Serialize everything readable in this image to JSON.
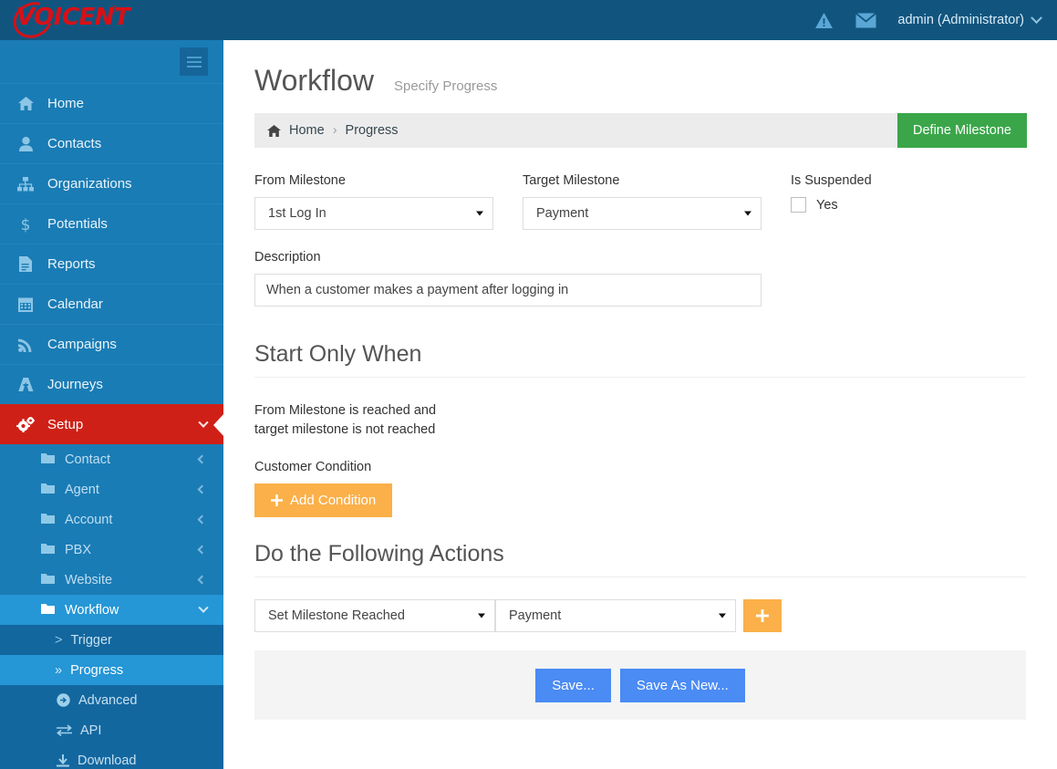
{
  "brand": {
    "logo_text": "VOICENT",
    "logo_registered": "®",
    "logo_color": "#d81016"
  },
  "header": {
    "warning_icon": "warning-triangle-icon",
    "mail_icon": "envelope-icon",
    "user_label": "admin (Administrator)",
    "bg_color": "#11557f"
  },
  "sidebar": {
    "bg_color": "#1a7cb5",
    "active_color": "#cf2017",
    "toggle_icon": "hamburger-icon",
    "items": [
      {
        "label": "Home",
        "icon": "home-icon"
      },
      {
        "label": "Contacts",
        "icon": "user-icon"
      },
      {
        "label": "Organizations",
        "icon": "sitemap-icon"
      },
      {
        "label": "Potentials",
        "icon": "dollar-icon"
      },
      {
        "label": "Reports",
        "icon": "file-text-icon"
      },
      {
        "label": "Calendar",
        "icon": "calendar-icon"
      },
      {
        "label": "Campaigns",
        "icon": "rss-icon"
      },
      {
        "label": "Journeys",
        "icon": "journey-icon"
      },
      {
        "label": "Setup",
        "icon": "gears-icon",
        "active": true,
        "expanded": true
      }
    ],
    "setup_children": [
      {
        "label": "Contact",
        "icon": "folder-icon",
        "chevron": "chevron-left-icon"
      },
      {
        "label": "Agent",
        "icon": "folder-icon",
        "chevron": "chevron-left-icon"
      },
      {
        "label": "Account",
        "icon": "folder-icon",
        "chevron": "chevron-left-icon"
      },
      {
        "label": "PBX",
        "icon": "folder-icon",
        "chevron": "chevron-left-icon"
      },
      {
        "label": "Website",
        "icon": "folder-icon",
        "chevron": "chevron-left-icon"
      },
      {
        "label": "Workflow",
        "icon": "folder-icon",
        "chevron": "chevron-down-icon",
        "selected": true
      }
    ],
    "workflow_children": [
      {
        "label": "Trigger",
        "marker": ">"
      },
      {
        "label": "Progress",
        "marker": "»",
        "active": true
      },
      {
        "label": "Advanced",
        "icon": "arrow-circle-right-icon"
      },
      {
        "label": "API",
        "icon": "exchange-icon"
      },
      {
        "label": "Download",
        "icon": "download-icon"
      }
    ]
  },
  "page": {
    "title": "Workflow",
    "subtitle": "Specify Progress",
    "breadcrumb": {
      "home_icon": "home-icon",
      "home": "Home",
      "separator": "›",
      "current": "Progress"
    },
    "define_milestone_label": "Define Milestone",
    "define_milestone_color": "#3aa649"
  },
  "form": {
    "from_milestone": {
      "label": "From Milestone",
      "value": "1st Log In"
    },
    "target_milestone": {
      "label": "Target Milestone",
      "value": "Payment"
    },
    "is_suspended": {
      "label": "Is Suspended",
      "checkbox_label": "Yes",
      "checked": false
    },
    "description": {
      "label": "Description",
      "value": "When a customer makes a payment after logging in"
    }
  },
  "start_only_when": {
    "heading": "Start Only When",
    "line1": "From Milestone is reached and",
    "line2": "target milestone is not reached",
    "customer_condition_label": "Customer Condition",
    "add_condition_label": "Add Condition",
    "add_condition_icon": "plus-icon",
    "add_condition_color": "#fbb049"
  },
  "actions": {
    "heading": "Do the Following Actions",
    "action_type": "Set Milestone Reached",
    "action_value": "Payment",
    "add_icon": "plus-icon"
  },
  "footer": {
    "save_label": "Save...",
    "save_as_new_label": "Save As New...",
    "button_color": "#4a8bf4"
  }
}
